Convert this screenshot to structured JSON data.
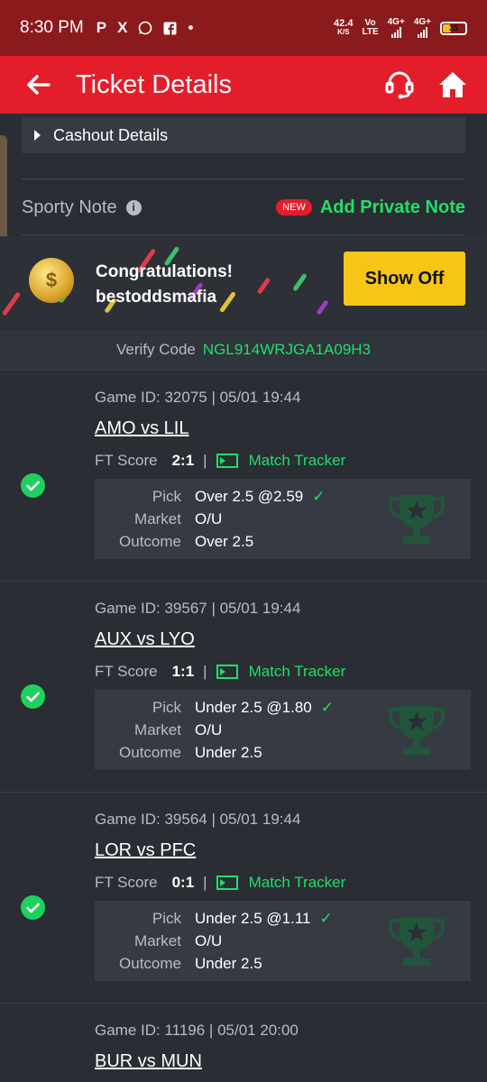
{
  "status_bar": {
    "time": "8:30 PM",
    "icons": [
      "P",
      "X",
      "whatsapp-icon",
      "facebook-icon",
      "•"
    ],
    "net_speed_value": "42.4",
    "net_speed_unit": "K/S",
    "volte_top": "Vo",
    "volte_bottom": "LTE",
    "sim1": "4G+",
    "sim2": "4G+",
    "battery": "35"
  },
  "header": {
    "title": "Ticket Details"
  },
  "cashout": {
    "label": "Cashout Details"
  },
  "sporty_note": {
    "label": "Sporty Note",
    "new_badge": "NEW",
    "add_label": "Add Private Note"
  },
  "banner": {
    "line1": "Congratulations!",
    "line2": "bestoddsmafia",
    "button": "Show Off"
  },
  "verify": {
    "label": "Verify Code",
    "code": "NGL914WRJGA1A09H3"
  },
  "games": [
    {
      "game_id": "Game ID: 32075 | 05/01 19:44",
      "teams": "AMO vs LIL",
      "ft_label": "FT Score",
      "score": "2:1",
      "separator": "|",
      "tracker": "Match Tracker",
      "pick_label": "Pick",
      "pick": "Over 2.5 @2.59",
      "market_label": "Market",
      "market": "O/U",
      "outcome_label": "Outcome",
      "outcome": "Over 2.5",
      "won": true
    },
    {
      "game_id": "Game ID: 39567 | 05/01 19:44",
      "teams": "AUX vs LYO",
      "ft_label": "FT Score",
      "score": "1:1",
      "separator": "|",
      "tracker": "Match Tracker",
      "pick_label": "Pick",
      "pick": "Under 2.5 @1.80",
      "market_label": "Market",
      "market": "O/U",
      "outcome_label": "Outcome",
      "outcome": "Under 2.5",
      "won": true
    },
    {
      "game_id": "Game ID: 39564 | 05/01 19:44",
      "teams": "LOR vs PFC",
      "ft_label": "FT Score",
      "score": "0:1",
      "separator": "|",
      "tracker": "Match Tracker",
      "pick_label": "Pick",
      "pick": "Under 2.5 @1.11",
      "market_label": "Market",
      "market": "O/U",
      "outcome_label": "Outcome",
      "outcome": "Under 2.5",
      "won": true
    },
    {
      "game_id": "Game ID: 11196 | 05/01 20:00",
      "teams": "BUR vs MUN"
    }
  ],
  "colors": {
    "status_bar": "#8b1a1d",
    "header": "#e41d2a",
    "accent_green": "#1fe06a",
    "button_yellow": "#f7c515",
    "background": "#2a2d33"
  }
}
